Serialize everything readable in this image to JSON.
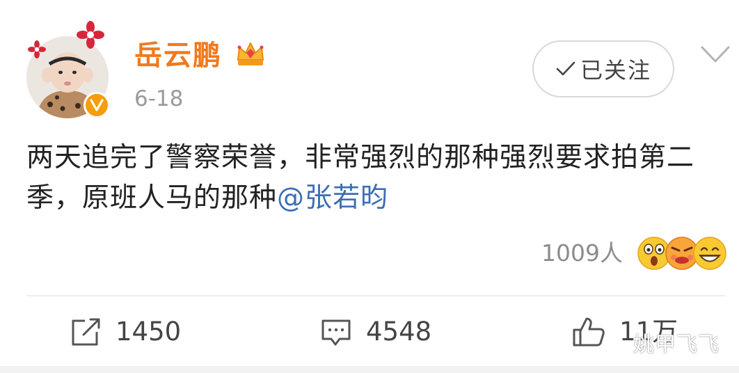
{
  "post": {
    "author": {
      "name": "岳云鹏"
    },
    "time": "6-18",
    "follow_label": "已关注",
    "text_main": "两天追完了警察荣誉，非常强烈的那种强烈要求拍第二季，原班人马的那种",
    "mention": "@张若昀"
  },
  "reactions": {
    "count": "1009人",
    "emojis": [
      "shocked-emoji",
      "angry-emoji",
      "grinning-emoji"
    ]
  },
  "actions": {
    "repost_count": "1450",
    "comment_count": "4548",
    "like_count": "11万"
  },
  "watermark": "姚甲飞飞",
  "colors": {
    "username": "#f07a1d",
    "mention": "#3c6fb4",
    "badge": "#f59d0c"
  }
}
